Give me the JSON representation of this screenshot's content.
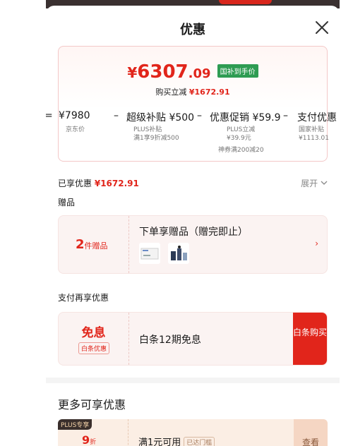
{
  "header": {
    "title": "优惠"
  },
  "price": {
    "currency": "¥",
    "integer": "6307",
    "decimal": ".09",
    "tag": "国补到手价",
    "reduce_label": "购买立减",
    "reduce_value": "¥1672.91"
  },
  "formula": {
    "items": [
      {
        "op": "=",
        "value": "¥7980",
        "sub": [
          "京东价"
        ]
      },
      {
        "op": "–",
        "value": "超级补贴 ¥500",
        "sub": [
          "PLUS补贴",
          "满1享9折减500"
        ]
      },
      {
        "op": "–",
        "value": "优惠促销 ¥59.9",
        "sub": [
          "PLUS立减",
          "¥39.9元",
          "神券满200减20"
        ]
      },
      {
        "op": "–",
        "value": "支付优惠",
        "sub": [
          "国家补贴",
          "¥1113.01"
        ]
      }
    ]
  },
  "enjoyed": {
    "label": "已享优惠",
    "value": "¥1672.91",
    "expand": "展开"
  },
  "gifts": {
    "section_label": "赠品",
    "count": "2",
    "count_suffix": "件赠品",
    "title": "下单享赠品（赠完即止）",
    "arrow": "›"
  },
  "payment": {
    "section_label": "支付再享优惠",
    "free_label": "免息",
    "free_tag": "白条优惠",
    "text": "白条12期免息",
    "button": "白条购买"
  },
  "more": {
    "title": "更多可享优惠",
    "coupon": {
      "badge": "PLUS专享",
      "discount_num": "9",
      "discount_unit": "折",
      "text": "满1元可用",
      "chip": "已达门槛",
      "button": "查看"
    }
  },
  "colors": {
    "accent": "#e1251b",
    "green_tag": "#2e9c53"
  }
}
